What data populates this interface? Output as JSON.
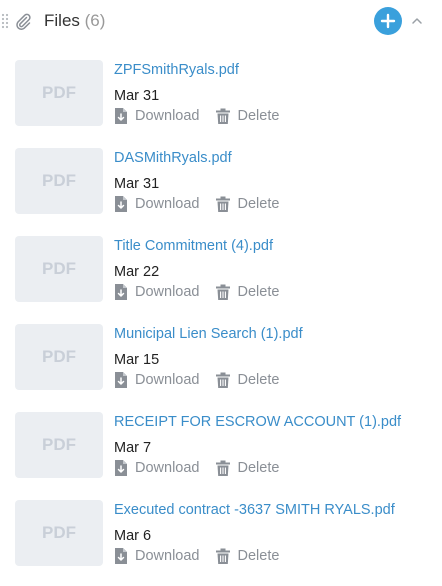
{
  "header": {
    "title": "Files",
    "count": "(6)",
    "icons": {
      "drag": "drag-handle-icon",
      "attachment": "paperclip-icon",
      "add": "plus-icon",
      "collapse": "chevron-up-icon"
    },
    "accent_color": "#3aa0dc"
  },
  "files": [
    {
      "thumb_label": "PDF",
      "name": "ZPFSmithRyals.pdf",
      "date": "Mar 31",
      "download_label": "Download",
      "delete_label": "Delete"
    },
    {
      "thumb_label": "PDF",
      "name": "DASMithRyals.pdf",
      "date": "Mar 31",
      "download_label": "Download",
      "delete_label": "Delete"
    },
    {
      "thumb_label": "PDF",
      "name": "Title Commitment (4).pdf",
      "date": "Mar 22",
      "download_label": "Download",
      "delete_label": "Delete"
    },
    {
      "thumb_label": "PDF",
      "name": "Municipal Lien Search (1).pdf",
      "date": "Mar 15",
      "download_label": "Download",
      "delete_label": "Delete"
    },
    {
      "thumb_label": "PDF",
      "name": "RECEIPT FOR ESCROW ACCOUNT (1).pdf",
      "date": "Mar 7",
      "download_label": "Download",
      "delete_label": "Delete"
    },
    {
      "thumb_label": "PDF",
      "name": "Executed contract -3637 SMITH RYALS.pdf",
      "date": "Mar 6",
      "download_label": "Download",
      "delete_label": "Delete"
    }
  ],
  "colors": {
    "link": "#3a8dc9",
    "muted": "#8a8f96",
    "thumb_bg": "#ebeef2",
    "thumb_text": "#c9cfd8"
  }
}
